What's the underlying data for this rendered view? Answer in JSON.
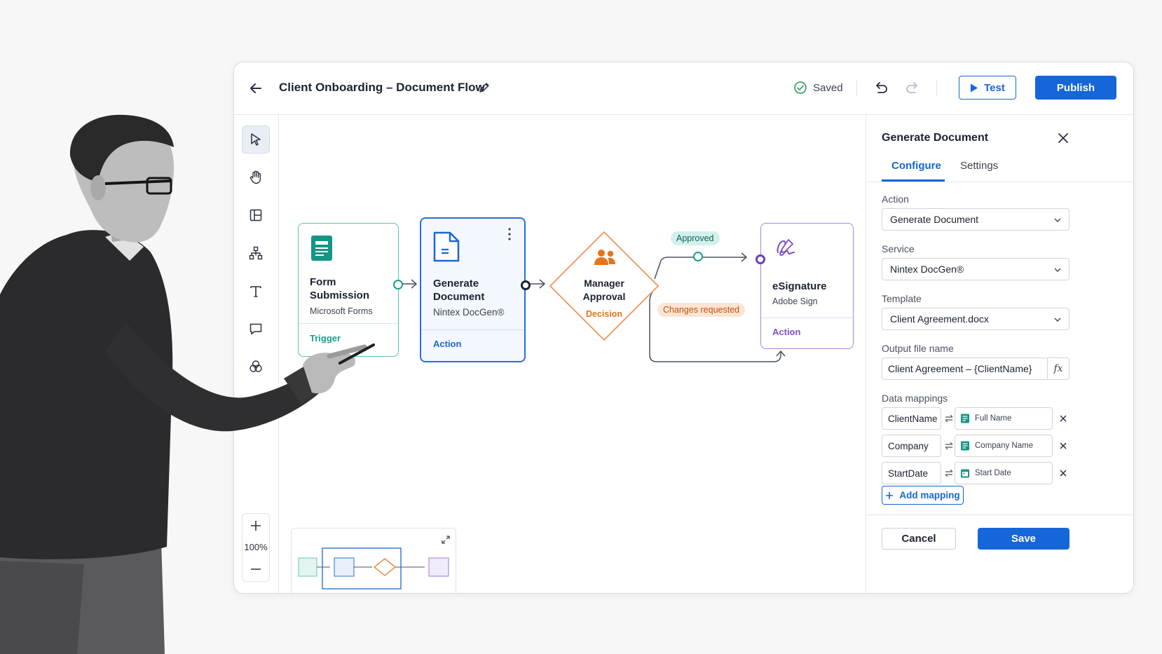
{
  "header": {
    "title": "Client Onboarding – Document Flow",
    "saved_label": "Saved",
    "test_label": "Test",
    "publish_label": "Publish"
  },
  "toolbar": {
    "tools": [
      "select-pointer-icon",
      "hand-pan-icon",
      "layout-panel-icon",
      "hierarchy-icon",
      "text-icon",
      "comment-icon",
      "integrations-icon"
    ],
    "zoom_level": "100%"
  },
  "canvas": {
    "nodes": [
      {
        "title_line1": "Form",
        "title_line2": "Submission",
        "subtitle": "Microsoft Forms",
        "tag": "Trigger"
      },
      {
        "title_line1": "Generate",
        "title_line2": "Document",
        "subtitle": "Nintex DocGen®",
        "tag": "Action"
      },
      {
        "title_line1": "Manager",
        "title_line2": "Approval",
        "tag": "Decision"
      },
      {
        "title_line1": "eSignature",
        "subtitle": "Adobe Sign",
        "tag": "Action"
      }
    ],
    "branches": {
      "approved": "Approved",
      "changes": "Changes requested"
    }
  },
  "panel": {
    "title": "Generate Document",
    "tabs": [
      "Configure",
      "Settings"
    ],
    "active_tab": "Configure",
    "action_label": "Action",
    "action_value": "Generate Document",
    "service_label": "Service",
    "service_value": "Nintex DocGen®",
    "template_label": "Template",
    "template_value": "Client Agreement.docx",
    "output_label": "Output file name",
    "output_value": "Client Agreement – {ClientName}",
    "fx_label": "fx",
    "mappings_label": "Data mappings",
    "mappings": [
      {
        "key": "ClientName",
        "value": "Full Name"
      },
      {
        "key": "Company",
        "value": "Company Name"
      },
      {
        "key": "StartDate",
        "value": "Start Date"
      }
    ],
    "add_mapping_label": "Add mapping",
    "cancel_label": "Cancel",
    "save_label": "Save"
  },
  "colors": {
    "primary": "#1566d8",
    "trigger": "#1a9e8f",
    "action": "#1a66d6",
    "decision": "#e8731c",
    "esign": "#7b4fc8"
  }
}
